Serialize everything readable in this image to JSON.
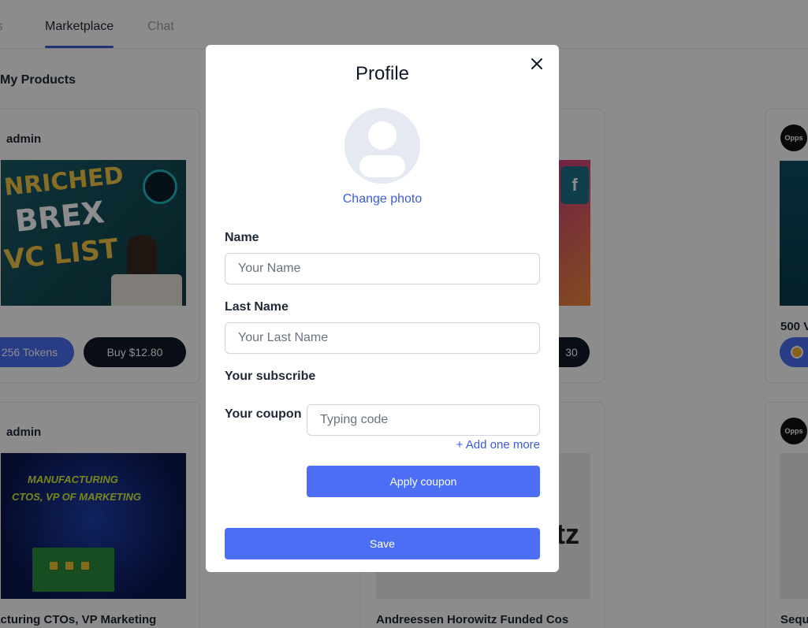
{
  "background": {
    "tabs": [
      {
        "label": "ts"
      },
      {
        "label": "Marketplace"
      },
      {
        "label": "Chat"
      }
    ],
    "section_title": "My Products",
    "cards": [
      {
        "author": "admin",
        "tokens_label": "256 Tokens",
        "buy_label": "Buy $12.80",
        "thumb_text": [
          "NRICHED",
          "BREX",
          "VC LIST"
        ]
      },
      {
        "buy_label": "30"
      },
      {
        "badge": "Opps",
        "title": "500 V"
      },
      {
        "author": "admin",
        "title": "ufacturing CTOs, VP Marketing",
        "thumb_text": [
          "MANUFACTURING",
          "CTOS, VP OF MARKETING"
        ]
      },
      {
        "title": "Andreessen Horowitz Funded Cos",
        "thumb_text": "tz"
      },
      {
        "badge": "Opps",
        "title": "Sequ"
      }
    ]
  },
  "modal": {
    "title": "Profile",
    "change_photo": "Change photo",
    "name_label": "Name",
    "name_placeholder": "Your Name",
    "last_name_label": "Last Name",
    "last_name_placeholder": "Your Last Name",
    "subscribe_label": "Your subscribe",
    "coupon_label": "Your coupon",
    "coupon_placeholder": "Typing code",
    "add_more": "+ Add one more",
    "apply_label": "Apply coupon",
    "save_label": "Save"
  },
  "colors": {
    "primary": "#4c6ef5",
    "link": "#3b5bdb",
    "overlay": "rgba(0,0,0,0.45)"
  }
}
